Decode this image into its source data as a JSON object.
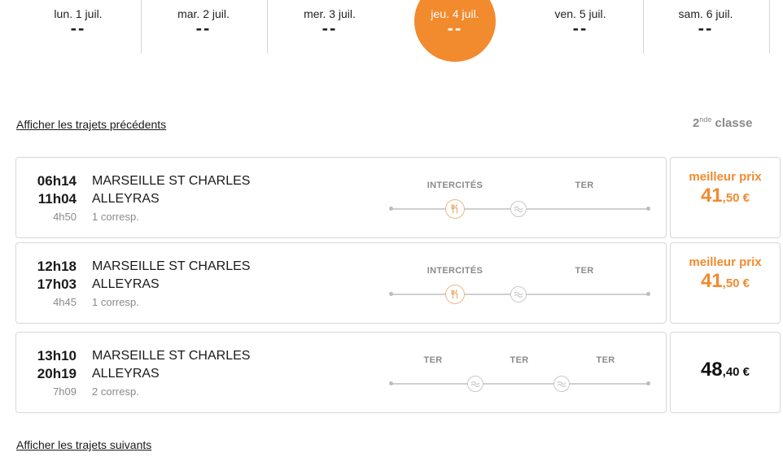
{
  "dates": [
    {
      "label": "lun. 1 juil.",
      "price": "--",
      "active": false
    },
    {
      "label": "mar. 2 juil.",
      "price": "--",
      "active": false
    },
    {
      "label": "mer. 3 juil.",
      "price": "--",
      "active": false
    },
    {
      "label": "jeu. 4 juil.",
      "price": "--",
      "active": true
    },
    {
      "label": "ven. 5 juil.",
      "price": "--",
      "active": false
    },
    {
      "label": "sam. 6 juil.",
      "price": "--",
      "active": false
    }
  ],
  "links": {
    "previous": "Afficher les trajets précédents",
    "next": "Afficher les trajets suivants"
  },
  "class_label": {
    "num": "2",
    "sup": "nde",
    "word": "classe"
  },
  "colors": {
    "accent": "#f28a2e",
    "border": "#d8d8d8",
    "muted": "#8a8a8a"
  },
  "trips": [
    {
      "departure": "06h14",
      "arrival": "11h04",
      "duration": "4h50",
      "from": "MARSEILLE ST CHARLES",
      "to": "ALLEYRAS",
      "connections": "1 corresp.",
      "segments": [
        "INTERCITÉS",
        "TER"
      ],
      "price": {
        "label": "meilleur prix",
        "euros": "41",
        "cents": ",50 €"
      }
    },
    {
      "departure": "12h18",
      "arrival": "17h03",
      "duration": "4h45",
      "from": "MARSEILLE ST CHARLES",
      "to": "ALLEYRAS",
      "connections": "1 corresp.",
      "segments": [
        "INTERCITÉS",
        "TER"
      ],
      "price": {
        "label": "meilleur prix",
        "euros": "41",
        "cents": ",50 €"
      }
    },
    {
      "departure": "13h10",
      "arrival": "20h19",
      "duration": "7h09",
      "from": "MARSEILLE ST CHARLES",
      "to": "ALLEYRAS",
      "connections": "2 corresp.",
      "segments": [
        "TER",
        "TER",
        "TER"
      ],
      "price": {
        "label": "",
        "euros": "48",
        "cents": ",40 €"
      }
    }
  ]
}
